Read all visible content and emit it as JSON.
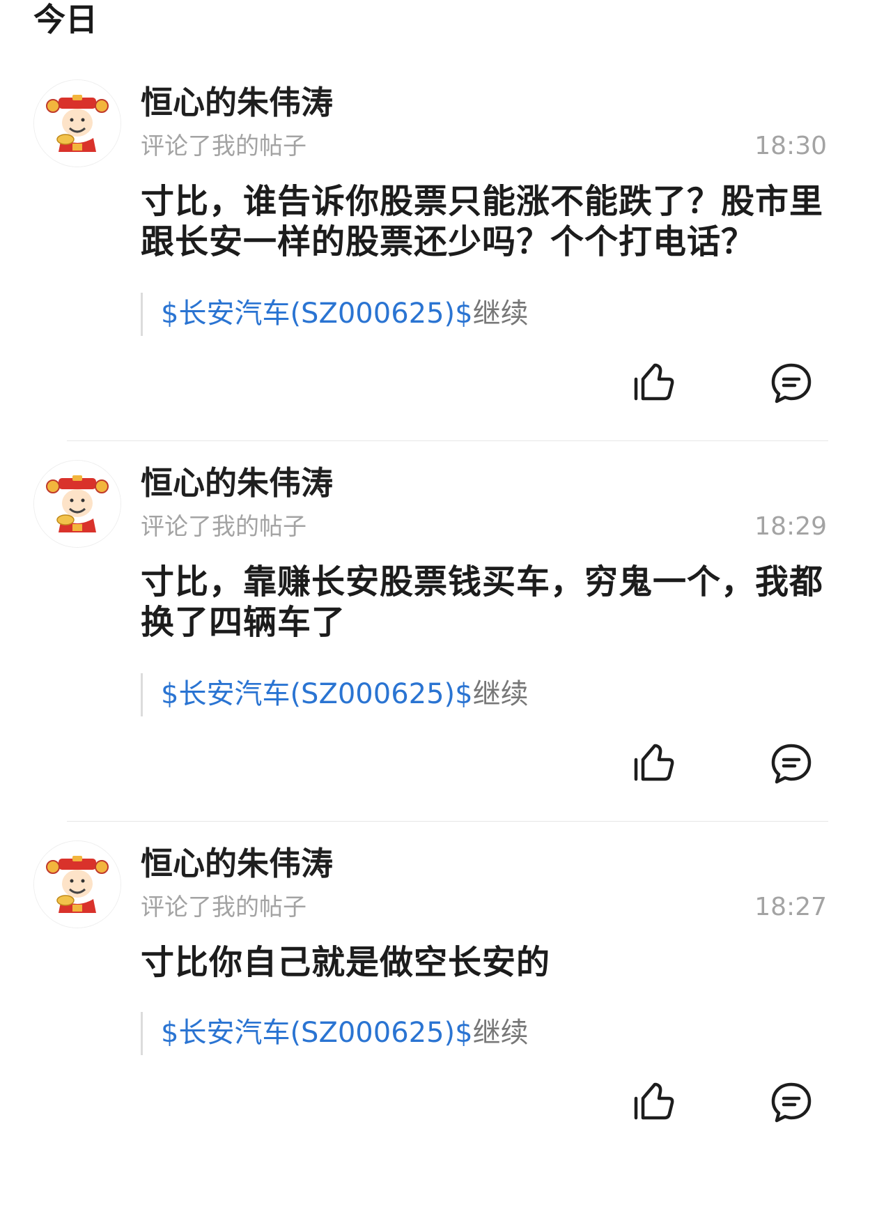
{
  "section": {
    "title": "今日"
  },
  "notifications": [
    {
      "user": "恒心的朱伟涛",
      "action": "评论了我的帖子",
      "time": "18:30",
      "content": "寸比，谁告诉你股票只能涨不能跌了？股市里跟长安一样的股票还少吗？个个打电话？",
      "quote_link": "$长安汽车(SZ000625)$",
      "quote_text": "继续"
    },
    {
      "user": "恒心的朱伟涛",
      "action": "评论了我的帖子",
      "time": "18:29",
      "content": "寸比，靠赚长安股票钱买车，穷鬼一个，我都换了四辆车了",
      "quote_link": "$长安汽车(SZ000625)$",
      "quote_text": "继续"
    },
    {
      "user": "恒心的朱伟涛",
      "action": "评论了我的帖子",
      "time": "18:27",
      "content": "寸比你自己就是做空长安的",
      "quote_link": "$长安汽车(SZ000625)$",
      "quote_text": "继续"
    }
  ],
  "icons": {
    "like": "thumbs-up-icon",
    "reply": "comment-bubble-icon",
    "avatar": "god-of-wealth-avatar"
  },
  "colors": {
    "link": "#2a74d2",
    "name": "#1f1f1f",
    "meta": "#a3a3a3"
  }
}
